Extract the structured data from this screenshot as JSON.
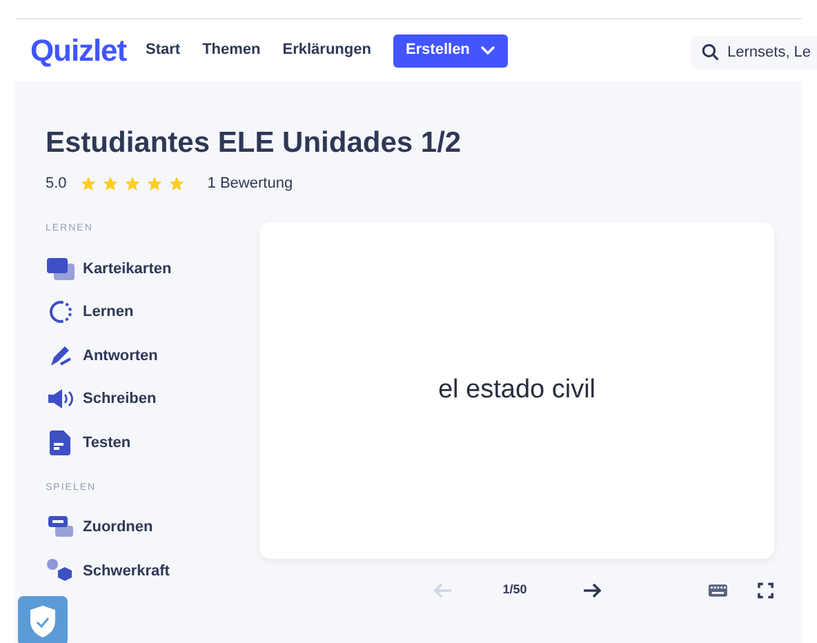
{
  "header": {
    "logo": "Quizlet",
    "nav": [
      "Start",
      "Themen",
      "Erklärungen"
    ],
    "create_button": "Erstellen",
    "search": {
      "placeholder": "Lernsets, Le"
    }
  },
  "set": {
    "title": "Estudiantes ELE Unidades 1/2",
    "rating": "5.0",
    "stars": 5,
    "reviews": "1 Bewertung"
  },
  "sidebar": [
    {
      "heading": "LERNEN",
      "items": [
        {
          "label": "Karteikarten",
          "kind": "cards"
        },
        {
          "label": "Lernen",
          "kind": "learn"
        },
        {
          "label": "Antworten",
          "kind": "write"
        },
        {
          "label": "Schreiben",
          "kind": "spell"
        },
        {
          "label": "Testen",
          "kind": "test"
        }
      ]
    },
    {
      "heading": "SPIELEN",
      "items": [
        {
          "label": "Zuordnen",
          "kind": "match"
        },
        {
          "label": "Schwerkraft",
          "kind": "gravity"
        }
      ]
    }
  ],
  "card": {
    "text": "el estado civil"
  },
  "controls": {
    "prev_disabled": true,
    "counter": "1/50",
    "next_disabled": false
  }
}
